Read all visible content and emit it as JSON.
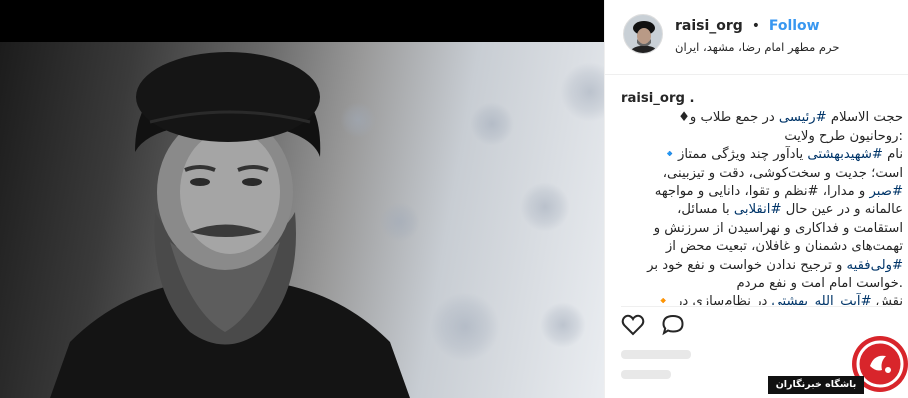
{
  "post": {
    "username": "raisi_org",
    "separator": "•",
    "follow_label": "Follow",
    "location": "حرم مطهر امام رضا، مشهد، ایران",
    "caption_author": "raisi_org .",
    "caption_lines": [
      {
        "pre": "حجت الاسلام ",
        "tag": "#رئیسی",
        "post": " در جمع طلاب و♦"
      },
      {
        "pre": ":روحانیون طرح ولایت",
        "tag": "",
        "post": ""
      },
      {
        "pre": "نام ",
        "tag": "#شهیدبهشتی",
        "post": " یادآور چند ویژگی ممتاز🔹"
      },
      {
        "pre": "است؛ جدیت و سخت‌کوشی، دقت و تیزبینی،",
        "tag": "",
        "post": ""
      },
      {
        "pre": "",
        "tag": "#صبر",
        "post": " و مدارا، #نظم و تقوا، دانایی و مواجهه"
      },
      {
        "pre": "عالمانه و در عین حال ",
        "tag": "#انقلابی",
        "post": " با مسائل،"
      },
      {
        "pre": "استقامت و فداکاری و نهراسیدن از سرزنش و",
        "tag": "",
        "post": ""
      },
      {
        "pre": "تهمت‌های دشمنان و غافلان، تبعیت محض از",
        "tag": "",
        "post": ""
      },
      {
        "pre": "",
        "tag": "#ولی‌فقیه",
        "post": " و ترجیح ندادن خواست و نفع خود بر"
      },
      {
        "pre": ".خواست امام امت و نفع مردم",
        "tag": "",
        "post": ""
      },
      {
        "pre": "نقش ",
        "tag": "#آیت_الله_بهشتی",
        "post": " در نظام‌سازی در 🔸"
      }
    ]
  },
  "actions": {
    "like_icon": "heart-outline-icon",
    "comment_icon": "speech-bubble-icon"
  },
  "watermark": {
    "label": "باشگاه خبرنگاران",
    "color": "#d8252b"
  },
  "colors": {
    "follow": "#3897f0",
    "hashtag": "#003569"
  }
}
